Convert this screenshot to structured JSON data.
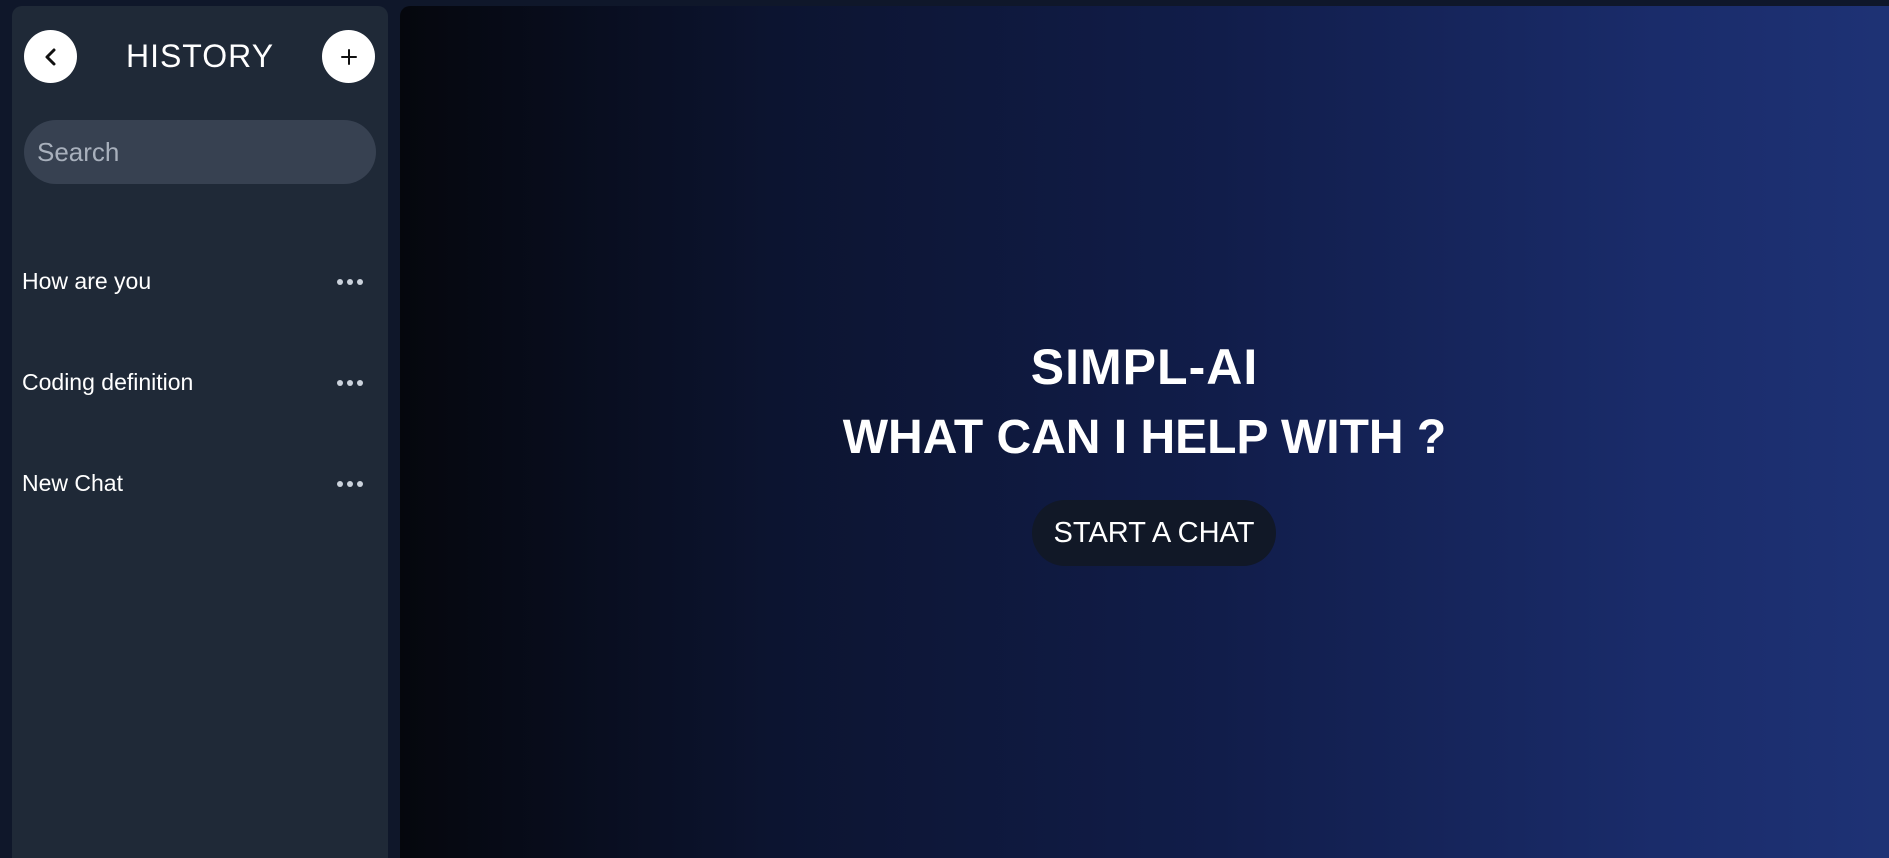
{
  "sidebar": {
    "title": "HISTORY",
    "back_icon": "chevron-left-icon",
    "add_icon": "plus-icon",
    "search": {
      "placeholder": "Search",
      "value": ""
    },
    "items": [
      {
        "label": "How are you",
        "menu_icon": "more-horizontal-icon"
      },
      {
        "label": "Coding definition",
        "menu_icon": "more-horizontal-icon"
      },
      {
        "label": "New Chat",
        "menu_icon": "more-horizontal-icon"
      }
    ]
  },
  "main": {
    "brand": "SIMPL-AI",
    "tagline": "WHAT CAN I HELP WITH ?",
    "start_button": "START A CHAT"
  },
  "colors": {
    "sidebar_bg": "#1f2937",
    "search_bg": "#374151",
    "button_bg": "#111827",
    "gradient_start": "#05070d",
    "gradient_end": "#1e3275"
  }
}
